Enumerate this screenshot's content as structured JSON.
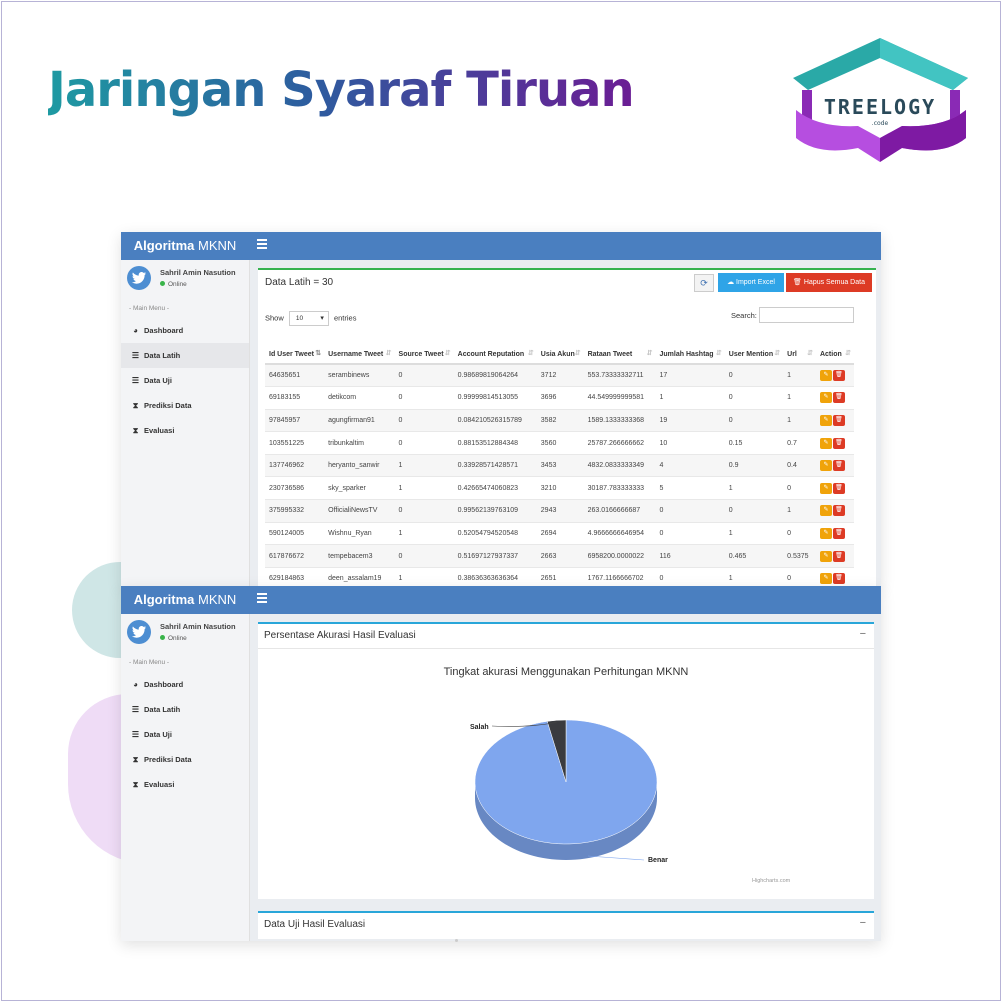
{
  "page": {
    "headline": "Jaringan Syaraf Tiruan",
    "logo": {
      "text": "TREELOGY",
      "subtext": ".code"
    }
  },
  "app": {
    "brand_bold": "Algoritma",
    "brand_rest": " MKNN",
    "user": {
      "name": "Sahril Amin Nasution",
      "status": "Online"
    },
    "menu_header": "- Main Menu -",
    "menu": [
      {
        "label": "Dashboard",
        "icon": "dashboard-icon"
      },
      {
        "label": "Data Latih",
        "icon": "database-icon"
      },
      {
        "label": "Data Uji",
        "icon": "database-icon"
      },
      {
        "label": "Prediksi Data",
        "icon": "hourglass-icon"
      },
      {
        "label": "Evaluasi",
        "icon": "hourglass-icon"
      }
    ]
  },
  "training": {
    "title": "Data Latih = 30",
    "import_label": "Import Excel",
    "delete_all_label": "Hapus Semua Data",
    "show_label": "Show",
    "entries_label": "entries",
    "page_length": "10",
    "search_label": "Search:",
    "columns": [
      "Id User Tweet",
      "Username Tweet",
      "Source Tweet",
      "Account Reputation",
      "Usia Akun",
      "Rataan Tweet",
      "Jumlah Hashtag",
      "User Mention",
      "Url",
      "Action"
    ],
    "rows": [
      [
        "64635651",
        "serambinews",
        "0",
        "0.98689819064264",
        "3712",
        "553.73333332711",
        "17",
        "0",
        "1"
      ],
      [
        "69183155",
        "detikcom",
        "0",
        "0.99999814513055",
        "3696",
        "44.549999999581",
        "1",
        "0",
        "1"
      ],
      [
        "97845957",
        "agungfirman91",
        "0",
        "0.084210526315789",
        "3582",
        "1589.1333333368",
        "19",
        "0",
        "1"
      ],
      [
        "103551225",
        "tribunkaltim",
        "0",
        "0.88153512884348",
        "3560",
        "25787.266666662",
        "10",
        "0.15",
        "0.7"
      ],
      [
        "137746962",
        "heryanto_sanwir",
        "1",
        "0.33928571428571",
        "3453",
        "4832.0833333349",
        "4",
        "0.9",
        "0.4"
      ],
      [
        "230736586",
        "sky_sparker",
        "1",
        "0.42665474060823",
        "3210",
        "30187.783333333",
        "5",
        "1",
        "0"
      ],
      [
        "375995332",
        "OfficialiNewsTV",
        "0",
        "0.99562139763109",
        "2943",
        "263.0166666687",
        "0",
        "0",
        "1"
      ],
      [
        "590124005",
        "Wishnu_Ryan",
        "1",
        "0.52054794520548",
        "2694",
        "4.9666666646954",
        "0",
        "1",
        "0"
      ],
      [
        "617876672",
        "tempebacem3",
        "0",
        "0.51697127937337",
        "2663",
        "6958200.0000022",
        "116",
        "0.465",
        "0.5375"
      ],
      [
        "629184863",
        "deen_assalam19",
        "1",
        "0.38636363636364",
        "2651",
        "1767.1166666702",
        "0",
        "1",
        "0"
      ]
    ]
  },
  "evaluation": {
    "panel_title": "Persentase Akurasi Hasil Evaluasi",
    "collapse_symbol": "−",
    "test_panel_title": "Data Uji Hasil Evaluasi",
    "credits": "Highcharts.com"
  },
  "chart_data": {
    "type": "pie",
    "title": "Tingkat akurasi Menggunakan Perhitungan MKNN",
    "categories": [
      "Benar",
      "Salah"
    ],
    "values": [
      96.7,
      3.3
    ],
    "colors": [
      "#7fa6ee",
      "#3a3b3f"
    ]
  }
}
